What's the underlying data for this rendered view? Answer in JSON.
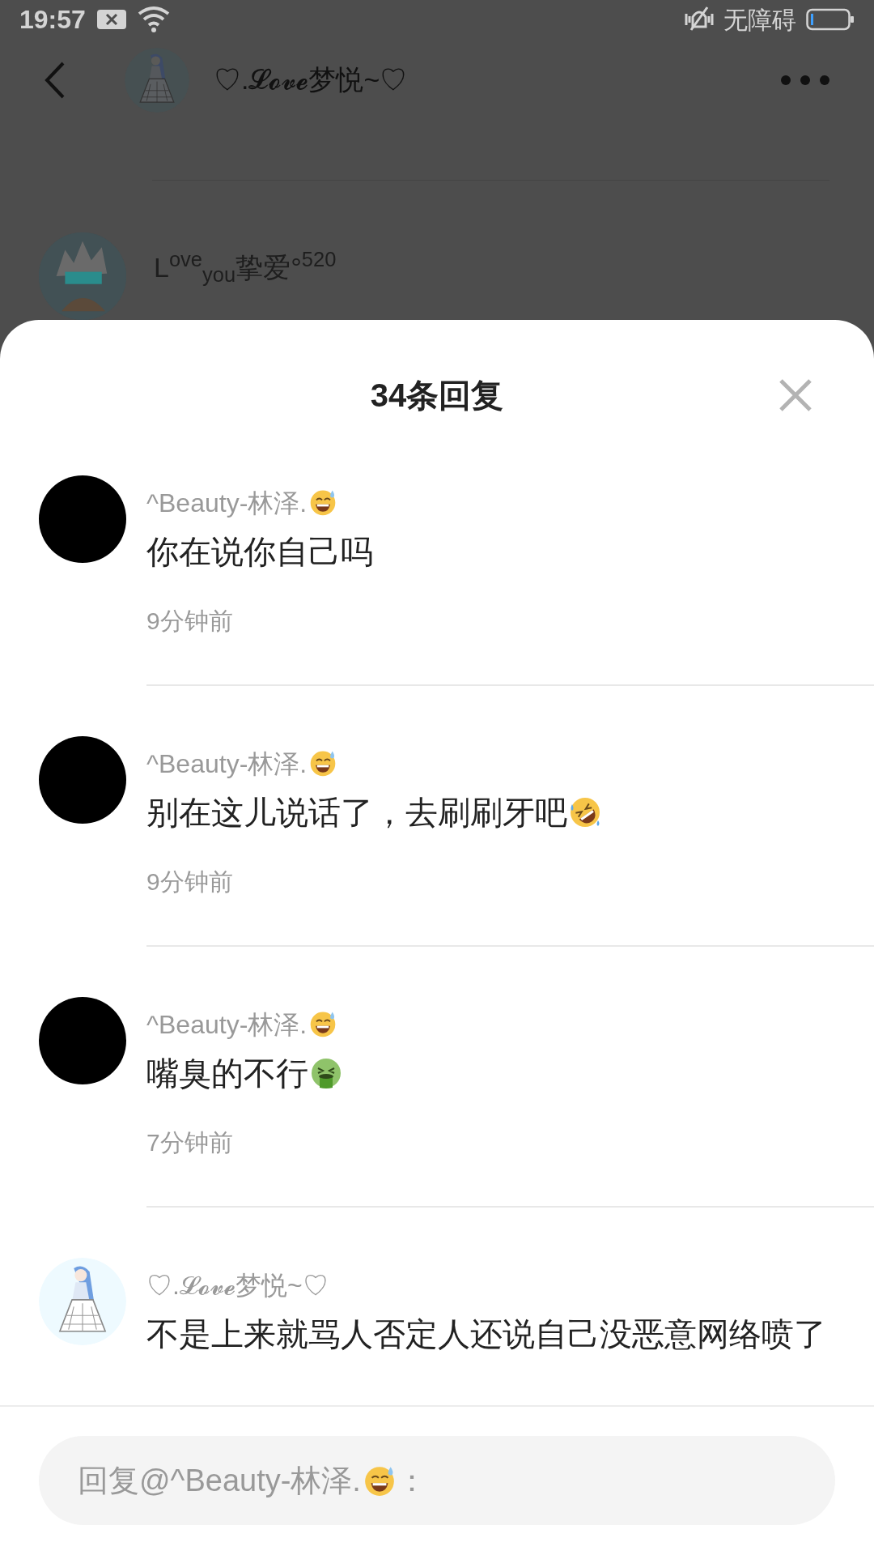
{
  "status_bar": {
    "time": "19:57",
    "accessibility": "无障碍"
  },
  "header": {
    "title": "♡.𝓛𝓸𝓿𝓮梦悦~♡"
  },
  "behind_comment": {
    "author": "L$^{ove}$$_{you}$挚爱°$^{520}$"
  },
  "sheet": {
    "title": "34条回复"
  },
  "replies": [
    {
      "kind": "plain",
      "author": "^Beauty-林泽.",
      "author_emoji": {
        "kind": "sweat_smile"
      },
      "text": "你在说你自己吗",
      "time": "9分钟前"
    },
    {
      "kind": "plain",
      "author": "^Beauty-林泽.",
      "author_emoji": {
        "kind": "sweat_smile"
      },
      "text": "别在这儿说话了，去刷刷牙吧",
      "text_emoji": {
        "kind": "rofl"
      },
      "time": "9分钟前"
    },
    {
      "kind": "plain",
      "author": "^Beauty-林泽.",
      "author_emoji": {
        "kind": "sweat_smile"
      },
      "text": "嘴臭的不行",
      "text_emoji": {
        "kind": "nauseated"
      },
      "time": "7分钟前"
    },
    {
      "kind": "picture",
      "author": "♡.𝓛𝓸𝓿𝓮梦悦~♡",
      "text": "不是上来就骂人否定人还说自己没恶意网络喷了"
    }
  ],
  "reply_box": {
    "prefix": "回复@^Beauty-林泽.",
    "emoji": {
      "kind": "sweat_smile"
    },
    "suffix": "："
  }
}
